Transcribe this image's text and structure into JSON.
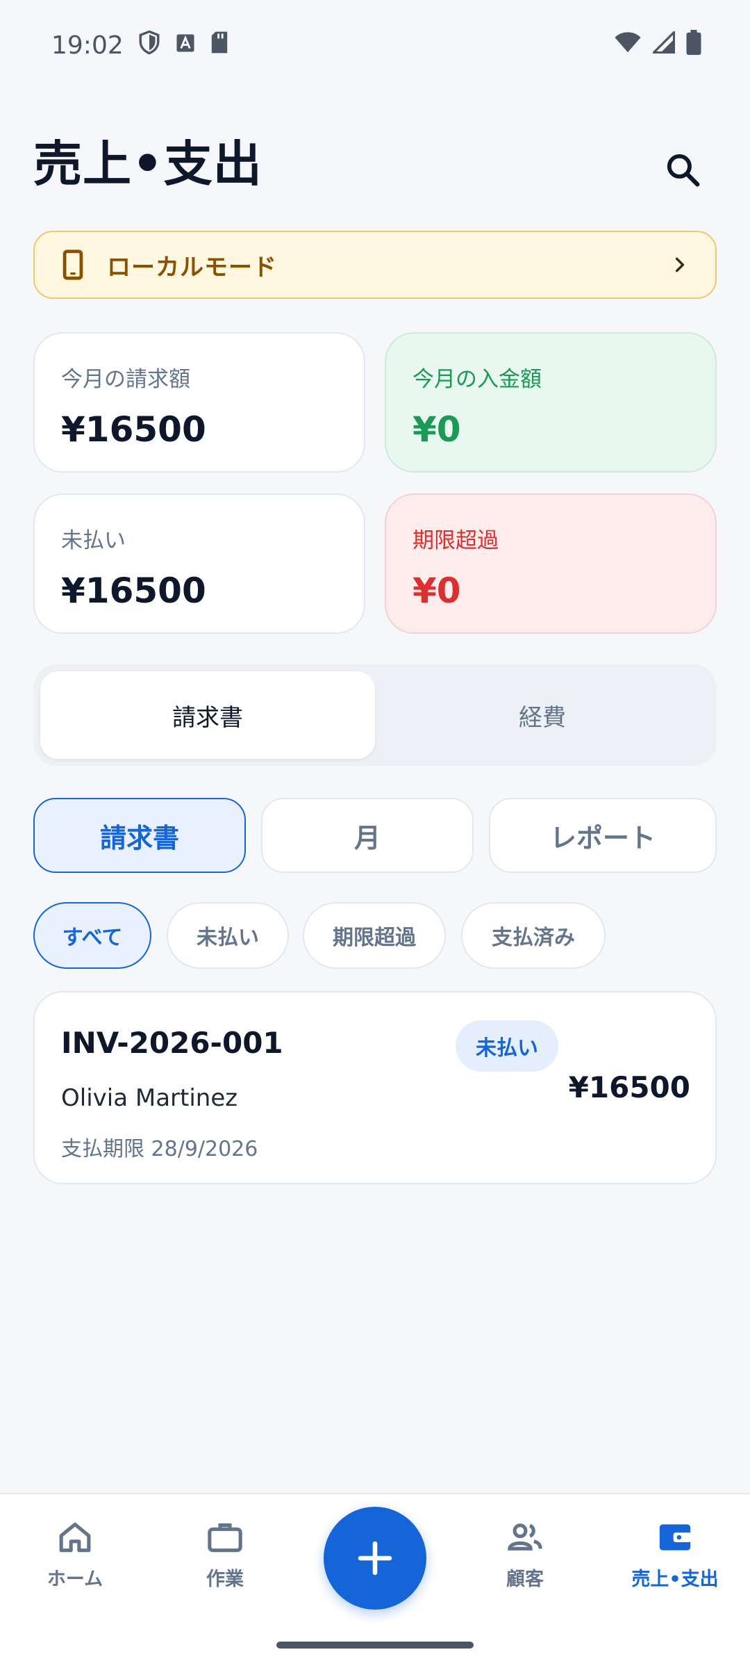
{
  "status_bar": {
    "time": "19:02",
    "icons": [
      "shield-icon",
      "font-a-icon",
      "sd-card-icon",
      "wifi-icon",
      "signal-icon",
      "battery-icon"
    ]
  },
  "header": {
    "title": "売上•支出",
    "search_icon": "search-icon"
  },
  "banner": {
    "icon": "phone-icon",
    "label": "ローカルモード",
    "chevron": "chevron-right-icon"
  },
  "stats": [
    {
      "label": "今月の請求額",
      "value": "¥16500"
    },
    {
      "label": "今月の入金額",
      "value": "¥0"
    },
    {
      "label": "未払い",
      "value": "¥16500"
    },
    {
      "label": "期限超過",
      "value": "¥0"
    }
  ],
  "segment": {
    "items": [
      "請求書",
      "経費"
    ],
    "selected": "請求書"
  },
  "view_tabs": {
    "items": [
      "請求書",
      "月",
      "レポート"
    ],
    "selected": "請求書"
  },
  "filter_chips": {
    "items": [
      "すべて",
      "未払い",
      "期限超過",
      "支払済み"
    ],
    "selected": "すべて"
  },
  "invoices": [
    {
      "id": "INV-2026-001",
      "customer": "Olivia Martinez",
      "due": "支払期限 28/9/2026",
      "status": "未払い",
      "amount": "¥16500"
    }
  ],
  "bottom_nav": {
    "items": [
      {
        "label": "ホーム",
        "icon": "home-icon"
      },
      {
        "label": "作業",
        "icon": "briefcase-icon"
      },
      {
        "label": "顧客",
        "icon": "people-icon"
      },
      {
        "label": "売上•支出",
        "icon": "wallet-icon"
      }
    ],
    "active": "売上•支出",
    "fab_icon": "plus-icon"
  },
  "colors": {
    "accent": "#1565d8",
    "background": "#f5f7fb",
    "success": "#1a9a55",
    "danger": "#dc2f2f",
    "warning_bg": "#fff7e0",
    "warning_text": "#8a5200"
  }
}
